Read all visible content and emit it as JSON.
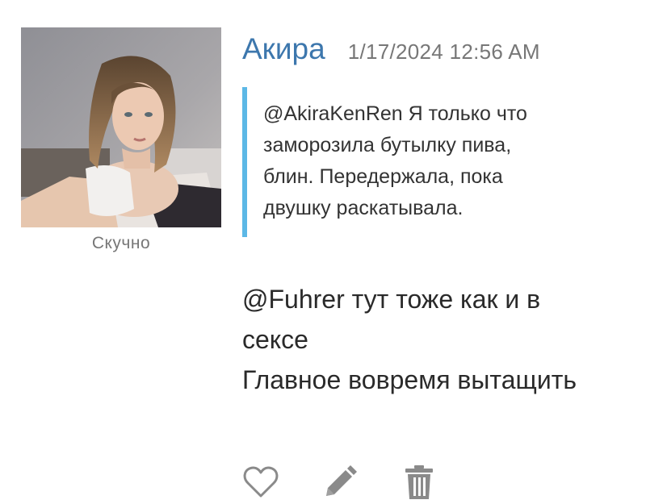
{
  "post": {
    "author": {
      "name": "Акира",
      "status": "Скучно",
      "avatar_icon": "user-avatar-photo"
    },
    "date": "1/17/2024 12:56 AM",
    "quote": {
      "text": "@AkiraKenRen Я только что\nзаморозила бутылку пива,\nблин. Передержала, пока\nдвушку раскатывала."
    },
    "message": {
      "lines": [
        "@Fuhrer тут тоже как и в",
        "сексе",
        "Главное вовремя вытащить"
      ]
    },
    "actions": [
      {
        "name": "like",
        "icon": "heart-icon"
      },
      {
        "name": "edit",
        "icon": "pencil-icon"
      },
      {
        "name": "delete",
        "icon": "trash-icon"
      }
    ]
  },
  "colors": {
    "author_name": "#3d77ad",
    "quote_bar": "#5cb8e6",
    "icon_gray": "#8a8a8a",
    "muted_text": "#777777"
  }
}
